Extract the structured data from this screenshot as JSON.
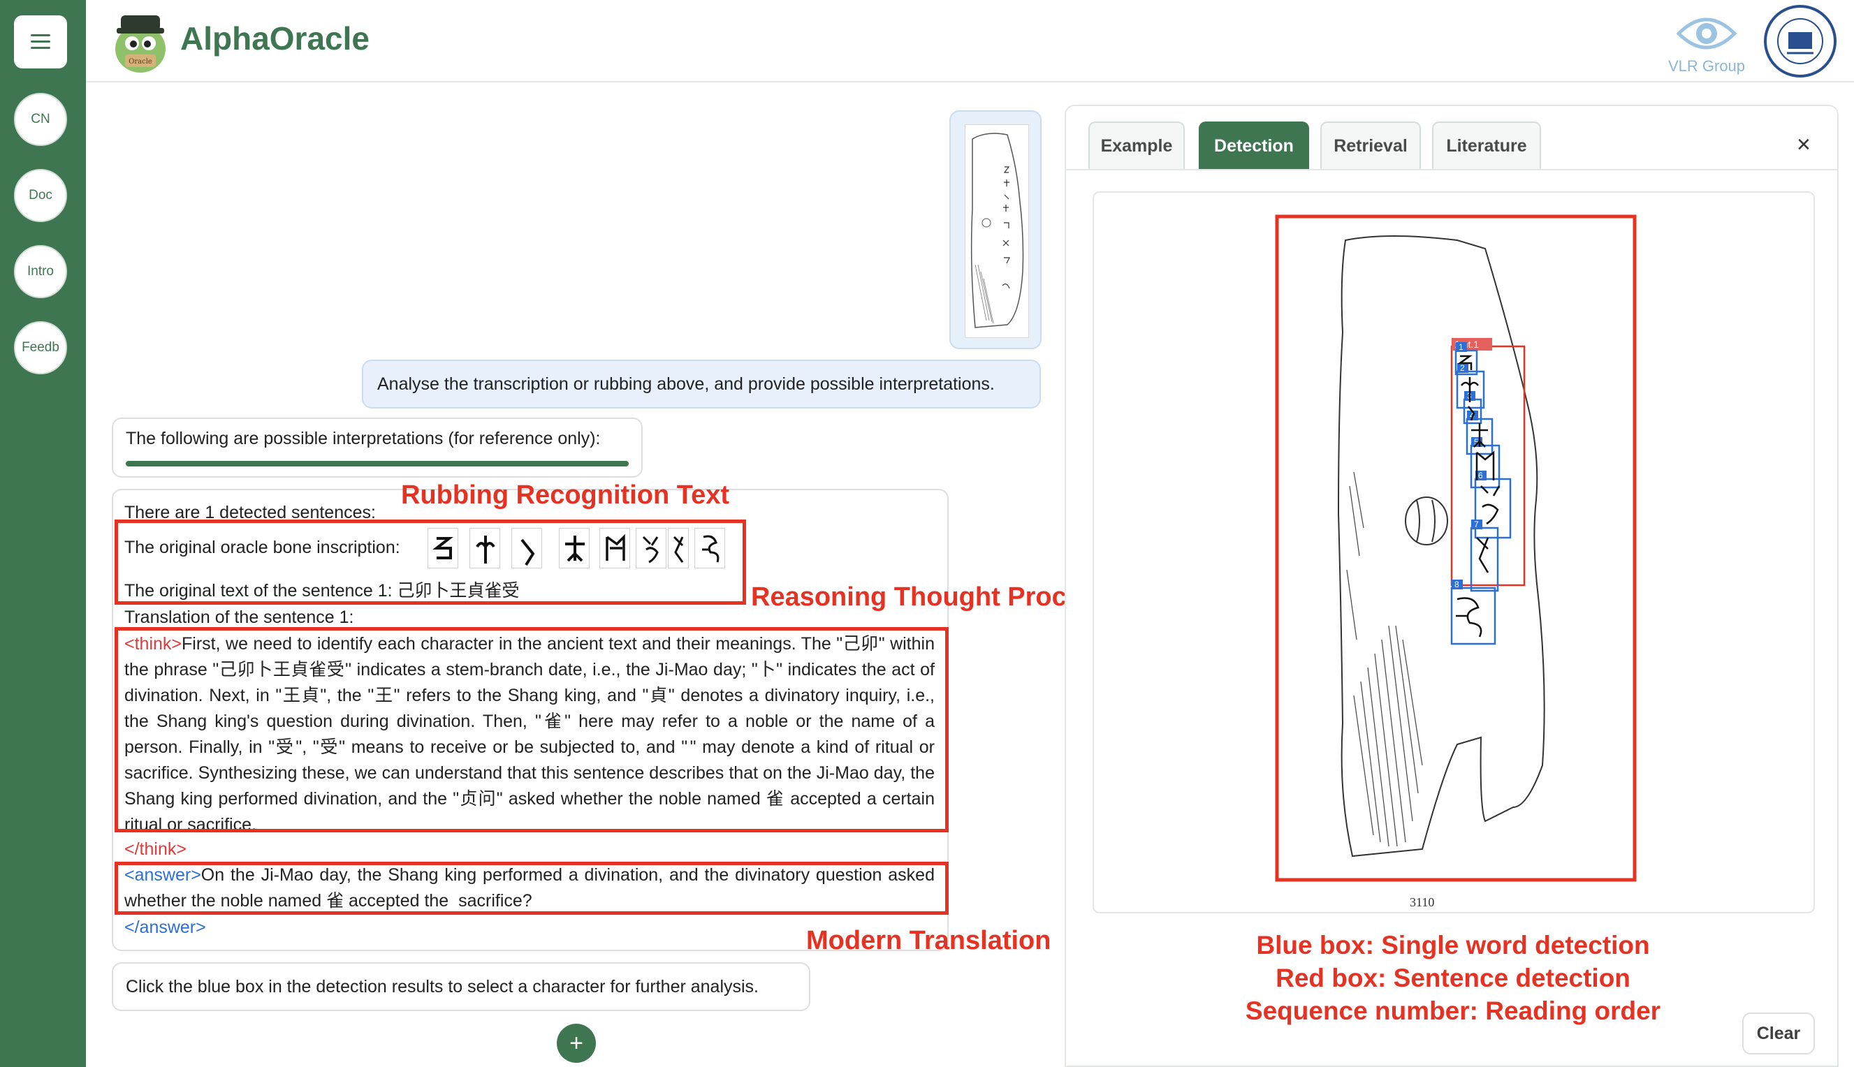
{
  "app": {
    "title": "AlphaOracle"
  },
  "header": {
    "vlr_label": "VLR Group"
  },
  "sidebar": {
    "items": [
      {
        "label": "CN"
      },
      {
        "label": "Doc"
      },
      {
        "label": "Intro"
      },
      {
        "label": "Feedb"
      }
    ]
  },
  "chat": {
    "user_prompt": "Analyse the transcription or rubbing above, and provide possible interpretations.",
    "intro_reply": "The following are possible interpretations (for reference only):",
    "detected_count_text": "There are 1 detected sentences:",
    "inscription_label": "The original oracle bone inscription:",
    "original_text": "The original text of the sentence 1: 己卯卜王貞雀受𩛊",
    "translation_label": "Translation of the sentence 1:",
    "think_open": "<think>",
    "think_text": "First, we need to identify each character in the ancient text and their meanings. The \"己卯\" within the phrase \"己卯卜王貞雀受𩛊\" indicates a stem-branch date, i.e., the Ji-Mao day; \"卜\" indicates the act of divination. Next, in \"王貞\", the \"王\" refers to the Shang king, and \"貞\" denotes a divinatory inquiry, i.e., the Shang king's question during divination. Then, \"雀\" here may refer to a noble or the name of a person. Finally, in \"受𩛊\", \"受\" means to receive or be subjected to, and \"𩛊\" may denote a kind of ritual or sacrifice. Synthesizing these, we can understand that this sentence describes that on the Ji-Mao day, the Shang king performed divination, and the \"贞问\" asked whether the noble named 雀 accepted a certain ritual or sacrifice.",
    "think_close": "</think>",
    "answer_open": "<answer>",
    "answer_text": "On the Ji-Mao day, the Shang king performed a divination, and the divinatory question asked whether the noble named 雀 accepted the 𩛊 sacrifice?",
    "answer_close": "</answer>",
    "hint": "Click the blue box in the detection results to select a character for further analysis.",
    "plus_label": "+"
  },
  "annotations": {
    "rubbing": "Rubbing Recognition Text",
    "reasoning": "Reasoning Thought Process",
    "modern": "Modern Translation"
  },
  "detection": {
    "tabs": [
      {
        "label": "Example"
      },
      {
        "label": "Detection"
      },
      {
        "label": "Retrieval"
      },
      {
        "label": "Literature"
      }
    ],
    "active_tab": "Detection",
    "close_label": "×",
    "sentence_label": "1 nt.1",
    "char_numbers": [
      "1",
      "2",
      "3",
      "4",
      "5",
      "6",
      "7",
      "8"
    ],
    "plate_number": "3110",
    "legend": [
      "Blue box: Single word detection",
      "Red box: Sentence detection",
      "Sequence number: Reading order"
    ],
    "clear_label": "Clear"
  },
  "colors": {
    "brand_green": "#3f7652",
    "annotation_red": "#e53223",
    "detect_blue": "#2c6fd6"
  }
}
